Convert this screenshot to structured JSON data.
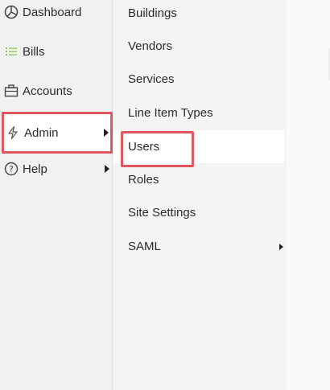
{
  "sidebar": {
    "items": [
      {
        "label": "Dashboard",
        "icon": "dashboard-icon"
      },
      {
        "label": "Bills",
        "icon": "list-icon",
        "icon_color": "#8bc34a"
      },
      {
        "label": "Accounts",
        "icon": "briefcase-icon"
      },
      {
        "label": "Admin",
        "icon": "lightning-icon",
        "active": true,
        "has_submenu": true
      },
      {
        "label": "Help",
        "icon": "help-circle-icon",
        "has_submenu": true
      }
    ]
  },
  "submenu": {
    "items": [
      {
        "label": "Buildings"
      },
      {
        "label": "Vendors"
      },
      {
        "label": "Services"
      },
      {
        "label": "Line Item Types"
      },
      {
        "label": "Users",
        "highlighted": true
      },
      {
        "label": "Roles"
      },
      {
        "label": "Site Settings"
      },
      {
        "label": "SAML",
        "has_submenu": true
      }
    ]
  },
  "colors": {
    "highlight": "#e0575f",
    "sidebar_bg": "#f1f1f1",
    "bills_icon": "#8bc34a"
  }
}
